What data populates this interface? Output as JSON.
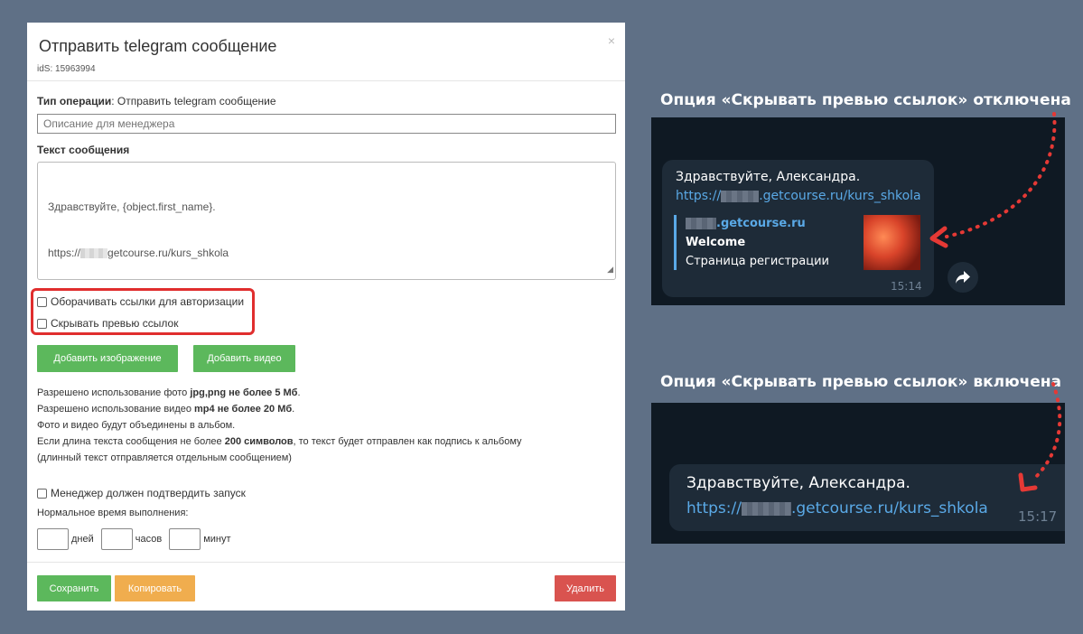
{
  "modal": {
    "title": "Отправить telegram сообщение",
    "ids": "idS: 15963994",
    "close": "×",
    "operation_label": "Тип операции",
    "operation_value": ": Отправить telegram сообщение",
    "description_placeholder": "Описание для менеджера",
    "message_label": "Текст сообщения",
    "message_line1": "Здравствуйте, {object.first_name}.",
    "message_line2_prefix": "https://",
    "message_line2_suffix": "getcourse.ru/kurs_shkola",
    "wrap_links_label": "Оборачивать ссылки для авторизации",
    "hide_preview_label": "Скрывать превью ссылок",
    "add_image_button": "Добавить изображение",
    "add_video_button": "Добавить видео",
    "info": {
      "line1_a": "Разрешено использование фото ",
      "line1_b": "jpg,png не более 5 Мб",
      "line1_c": ".",
      "line2_a": "Разрешено использование видео ",
      "line2_b": "mp4 не более 20 Мб",
      "line2_c": ".",
      "line3": "Фото и видео будут объединены в альбом.",
      "line4_a": "Если длина текста сообщения не более ",
      "line4_b": "200 символов",
      "line4_c": ", то текст будет отправлен как подпись к альбому",
      "line5": "(длинный текст отправляется отдельным сообщением)"
    },
    "manager_confirm_label": "Менеджер должен подтвердить запуск",
    "normal_time_label": "Нормальное время выполнения:",
    "units": {
      "days": "дней",
      "hours": "часов",
      "minutes": "минут"
    },
    "save_button": "Сохранить",
    "copy_button": "Копировать",
    "delete_button": "Удалить"
  },
  "examples": {
    "off_caption": "Опция «Скрывать превью ссылок» отключена",
    "on_caption": "Опция «Скрывать превью ссылок» включена",
    "greeting": "Здравствуйте, Александра.",
    "link_prefix": "https://",
    "link_suffix": ".getcourse.ru/kurs_shkola",
    "preview_domain": ".getcourse.ru",
    "preview_title": "Welcome",
    "preview_desc": "Страница регистрации",
    "time_off": "15:14",
    "time_on": "15:17"
  },
  "colors": {
    "background": "#5f7086",
    "green": "#5cb85c",
    "orange": "#f0ad4e",
    "red": "#d9534f",
    "highlight": "#e02e2e",
    "tg_link": "#5aa9e6"
  }
}
